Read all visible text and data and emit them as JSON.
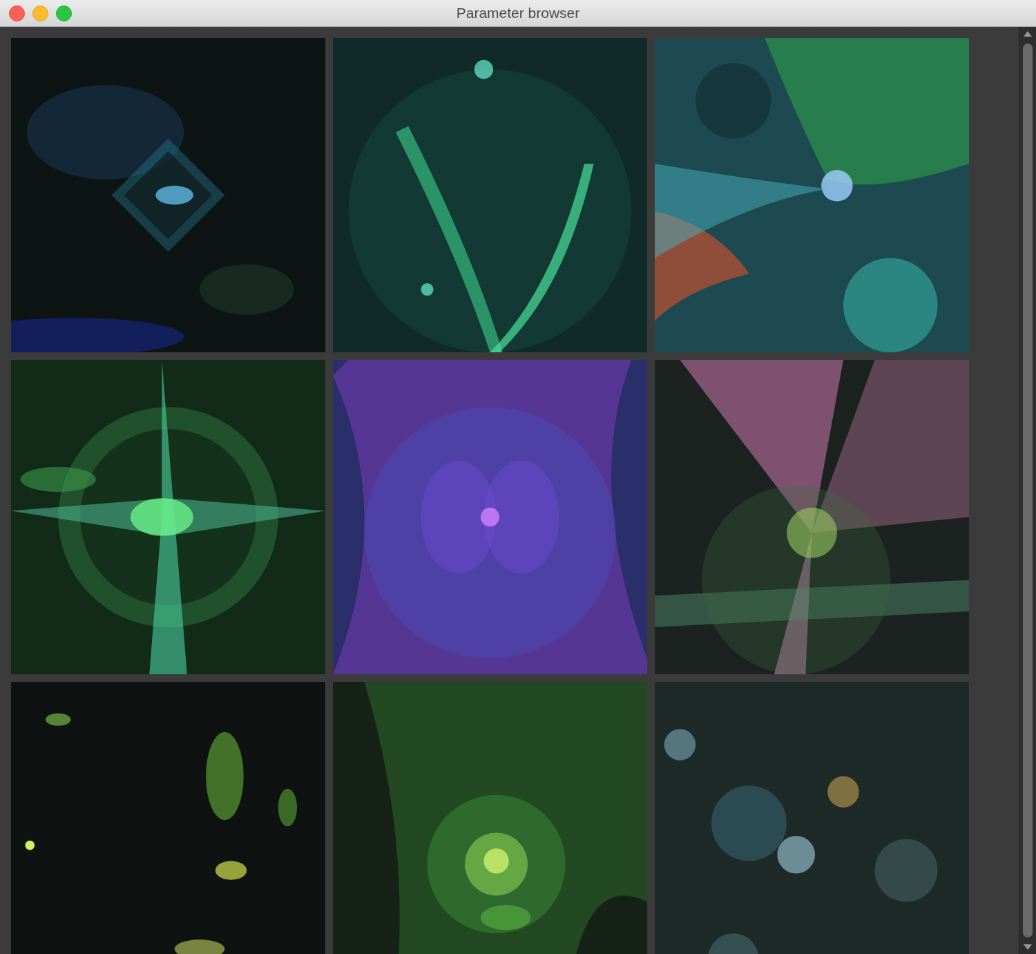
{
  "window": {
    "title": "Parameter browser"
  }
}
